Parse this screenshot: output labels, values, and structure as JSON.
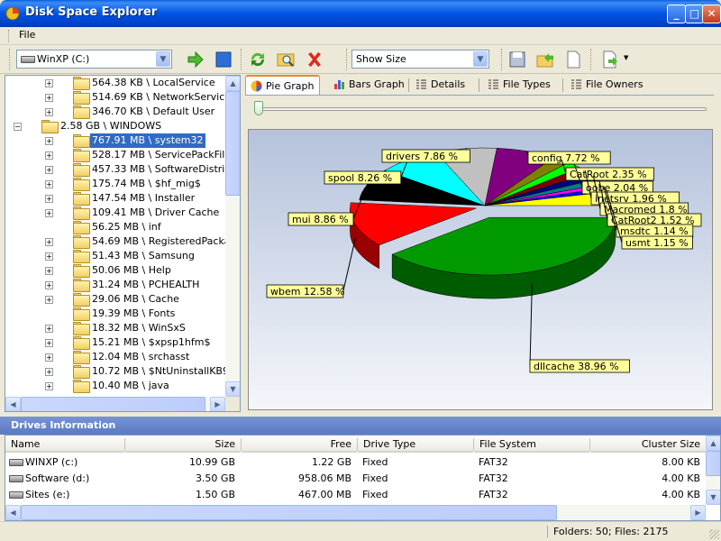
{
  "window": {
    "title": "Disk Space Explorer"
  },
  "menu": {
    "file": "File"
  },
  "toolbar": {
    "drive_combo": "WinXP (C:)",
    "view_combo": "Show Size"
  },
  "tree": {
    "rows": [
      {
        "label": "564.38 KB \\ LocalService",
        "expander": "+",
        "indent": 1
      },
      {
        "label": "514.69 KB \\ NetworkService",
        "expander": "+",
        "indent": 1
      },
      {
        "label": "346.70 KB \\ Default User",
        "expander": "+",
        "indent": 1
      },
      {
        "label": "2.58 GB \\ WINDOWS",
        "expander": "−",
        "indent": 0
      },
      {
        "label": "767.91 MB \\ system32",
        "expander": "+",
        "indent": 1,
        "selected": true
      },
      {
        "label": "528.17 MB \\ ServicePackFiles",
        "expander": "+",
        "indent": 1
      },
      {
        "label": "457.33 MB \\ SoftwareDistributi",
        "expander": "+",
        "indent": 1
      },
      {
        "label": "175.74 MB \\ $hf_mig$",
        "expander": "+",
        "indent": 1
      },
      {
        "label": "147.54 MB \\ Installer",
        "expander": "+",
        "indent": 1
      },
      {
        "label": "109.41 MB \\ Driver Cache",
        "expander": "+",
        "indent": 1
      },
      {
        "label": "56.25 MB \\ inf",
        "expander": "",
        "indent": 1
      },
      {
        "label": "54.69 MB \\ RegisteredPackage",
        "expander": "+",
        "indent": 1
      },
      {
        "label": "51.43 MB \\ Samsung",
        "expander": "+",
        "indent": 1
      },
      {
        "label": "50.06 MB \\ Help",
        "expander": "+",
        "indent": 1
      },
      {
        "label": "31.24 MB \\ PCHEALTH",
        "expander": "+",
        "indent": 1
      },
      {
        "label": "29.06 MB \\ Cache",
        "expander": "+",
        "indent": 1
      },
      {
        "label": "19.39 MB \\ Fonts",
        "expander": "",
        "indent": 1
      },
      {
        "label": "18.32 MB \\ WinSxS",
        "expander": "+",
        "indent": 1
      },
      {
        "label": "15.21 MB \\ $xpsp1hfm$",
        "expander": "+",
        "indent": 1
      },
      {
        "label": "12.04 MB \\ srchasst",
        "expander": "+",
        "indent": 1
      },
      {
        "label": "10.72 MB \\ $NtUninstallKB9128",
        "expander": "+",
        "indent": 1
      },
      {
        "label": "10.40 MB \\ java",
        "expander": "+",
        "indent": 1
      }
    ]
  },
  "tabs": [
    {
      "label": "Pie Graph",
      "active": true
    },
    {
      "label": "Bars Graph"
    },
    {
      "label": "Details"
    },
    {
      "label": "File Types"
    },
    {
      "label": "File Owners"
    }
  ],
  "chart_data": {
    "type": "pie",
    "labels": [
      "dllcache 38.96 %",
      "wbem 12.58 %",
      "mui 8.86 %",
      "spool 8.26 %",
      "drivers 7.86 %",
      "config 7.72 %",
      "CatRoot 2.35 %",
      "oobe 2.04 %",
      "inetsrv 1.96 %",
      "Macromed 1.8 %",
      "CatRoot2 1.52 %",
      "msdtc 1.14 %",
      "usmt 1.15 %"
    ],
    "slices": [
      {
        "name": "dllcache",
        "value": 38.96,
        "color": "#009900"
      },
      {
        "name": "wbem",
        "value": 12.58,
        "color": "#ff0000"
      },
      {
        "name": "mui",
        "value": 8.86,
        "color": "#000000"
      },
      {
        "name": "spool",
        "value": 8.26,
        "color": "#00ffff"
      },
      {
        "name": "drivers",
        "value": 7.86,
        "color": "#c0c0c0"
      },
      {
        "name": "config",
        "value": 7.72,
        "color": "#800080"
      },
      {
        "name": "CatRoot",
        "value": 2.35,
        "color": "#808000"
      },
      {
        "name": "oobe",
        "value": 2.04,
        "color": "#00ff00"
      },
      {
        "name": "inetsrv",
        "value": 1.96,
        "color": "#800000"
      },
      {
        "name": "Macromed",
        "value": 1.8,
        "color": "#000080"
      },
      {
        "name": "CatRoot2",
        "value": 1.52,
        "color": "#008080"
      },
      {
        "name": "msdtc",
        "value": 1.14,
        "color": "#ff00ff"
      },
      {
        "name": "usmt",
        "value": 1.15,
        "color": "#0000ff"
      },
      {
        "name": "other",
        "value": 3.8,
        "color": "#ffff00"
      }
    ]
  },
  "drives": {
    "section_title": "Drives Information",
    "columns": [
      "Name",
      "Size",
      "Free",
      "Drive Type",
      "File System",
      "Cluster Size"
    ],
    "rows": [
      {
        "name": "WINXP (c:)",
        "size": "10.99 GB",
        "free": "1.22 GB",
        "type": "Fixed",
        "fs": "FAT32",
        "cluster": "8.00 KB"
      },
      {
        "name": "Software (d:)",
        "size": "3.50 GB",
        "free": "958.06 MB",
        "type": "Fixed",
        "fs": "FAT32",
        "cluster": "4.00 KB"
      },
      {
        "name": "Sites (e:)",
        "size": "1.50 GB",
        "free": "467.00 MB",
        "type": "Fixed",
        "fs": "FAT32",
        "cluster": "4.00 KB"
      }
    ]
  },
  "status": {
    "text": "Folders: 50; Files: 2175"
  }
}
